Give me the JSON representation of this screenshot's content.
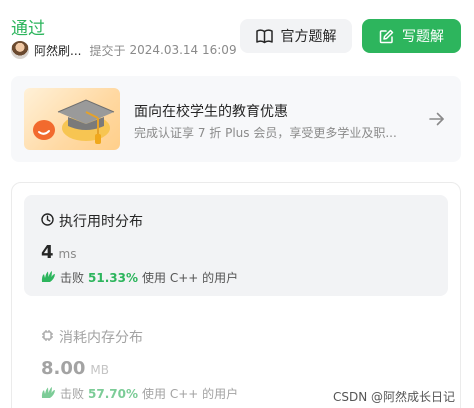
{
  "header": {
    "status": "通过",
    "author": "阿然刷...",
    "submit_label": "提交于",
    "submit_time": "2024.03.14 16:09",
    "official_solution_label": "官方题解",
    "write_solution_label": "写题解"
  },
  "promo": {
    "title": "面向在校学生的教育优惠",
    "subtitle": "完成认证享 7 折 Plus 会员，享受更多学业及职..."
  },
  "runtime": {
    "title": "执行用时分布",
    "value": "4",
    "unit": "ms",
    "beats_label": "击败",
    "beats_percent": "51.33%",
    "suffix": "使用 C++ 的用户"
  },
  "memory": {
    "title": "消耗内存分布",
    "value": "8.00",
    "unit": "MB",
    "beats_label": "击败",
    "beats_percent": "57.70%",
    "suffix": "使用 C++ 的用户"
  },
  "watermark": "CSDN @阿然成长日记",
  "colors": {
    "accent_green": "#2db55d",
    "panel_bg": "#f2f3f5"
  }
}
